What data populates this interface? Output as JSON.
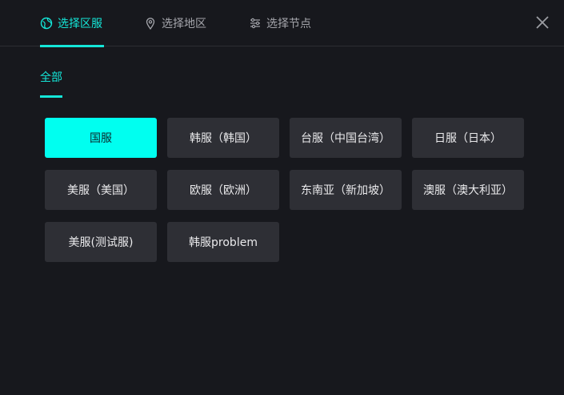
{
  "tabs": [
    {
      "label": "选择区服",
      "icon": "globe-icon",
      "active": true
    },
    {
      "label": "选择地区",
      "icon": "location-pin-icon",
      "active": false
    },
    {
      "label": "选择节点",
      "icon": "sliders-icon",
      "active": false
    }
  ],
  "subtab": {
    "label": "全部"
  },
  "servers": [
    {
      "label": "国服",
      "selected": true
    },
    {
      "label": "韩服（韩国）"
    },
    {
      "label": "台服（中国台湾）"
    },
    {
      "label": "日服（日本）"
    },
    {
      "label": "美服（美国）"
    },
    {
      "label": "欧服（欧洲）"
    },
    {
      "label": "东南亚（新加坡）"
    },
    {
      "label": "澳服（澳大利亚）"
    },
    {
      "label": "美服(测试服)"
    },
    {
      "label": "韩服problem"
    }
  ],
  "colors": {
    "accent": "#14e6d8",
    "selected_bg": "#00fff0",
    "background": "#17181d",
    "button_bg": "#2e2f35"
  }
}
